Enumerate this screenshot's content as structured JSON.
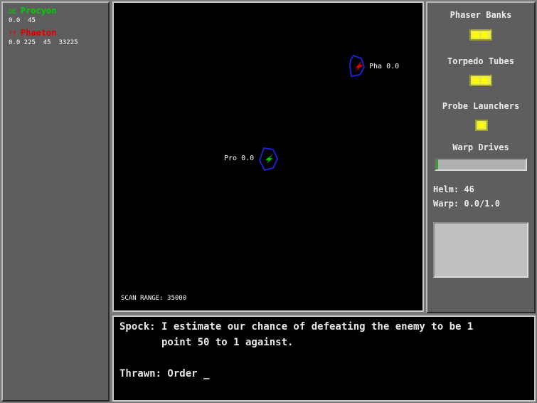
{
  "ships": [
    {
      "tag": "DE",
      "name": "Procyon",
      "stats": "0.0  45",
      "color": "#00d000"
    },
    {
      "tag": "??",
      "name": "Phaeton",
      "stats": "0.0 225  45  33225",
      "color": "#e00000"
    }
  ],
  "map": {
    "enemy_label": "Pha 0.0",
    "player_label": "Pro 0.0",
    "scan_range": "SCAN RANGE: 35000"
  },
  "systems": {
    "phaser_banks": "Phaser Banks",
    "torpedo_tubes": "Torpedo Tubes",
    "probe_launchers": "Probe Launchers",
    "warp_drives": "Warp Drives",
    "warp_level": 0.02,
    "helm": "Helm: 46",
    "warp": "Warp: 0.0/1.0"
  },
  "console": {
    "line1": "Spock: I estimate our chance of defeating the enemy to be 1",
    "line2": "       point 50 to 1 against.",
    "prompt": "Thrawn: Order _"
  }
}
